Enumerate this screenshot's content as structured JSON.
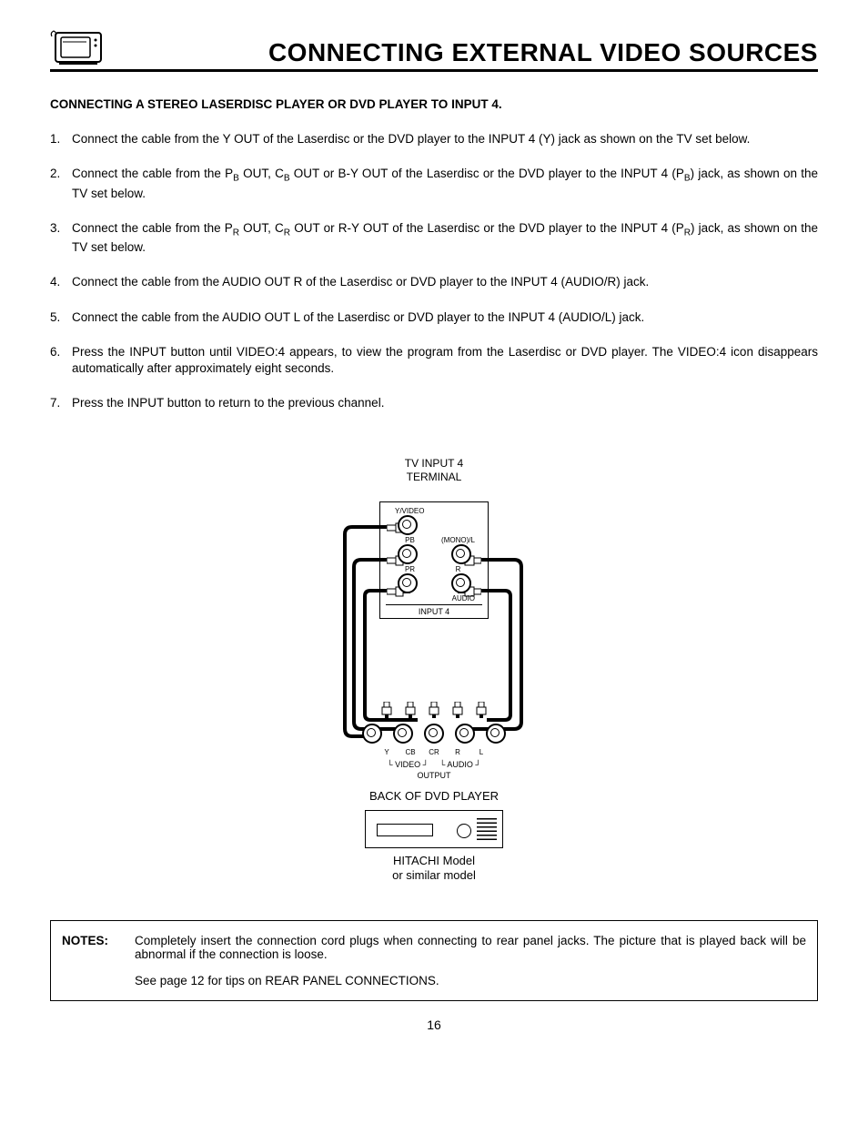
{
  "header": {
    "title": "CONNECTING EXTERNAL VIDEO SOURCES"
  },
  "subtitle": "CONNECTING A STEREO LASERDISC PLAYER OR DVD PLAYER TO INPUT 4.",
  "steps": [
    {
      "text_parts": [
        "Connect  the cable from the Y OUT of the Laserdisc or the DVD player to the INPUT 4 (Y) jack as shown on the TV set below."
      ]
    },
    {
      "text_parts": [
        "Connect the cable from the P",
        {
          "sub": "B"
        },
        " OUT, C",
        {
          "sub": "B"
        },
        " OUT or B-Y OUT of the Laserdisc or the DVD player to the INPUT 4 (P",
        {
          "sub": "B"
        },
        ") jack, as shown on the TV set below."
      ]
    },
    {
      "text_parts": [
        "Connect the cable from the P",
        {
          "sub": "R"
        },
        " OUT, C",
        {
          "sub": "R"
        },
        " OUT or R-Y OUT of the Laserdisc or the DVD player to the INPUT 4 (P",
        {
          "sub": "R"
        },
        ") jack, as shown on the TV set below."
      ]
    },
    {
      "text_parts": [
        "Connect the cable from the AUDIO OUT R of the Laserdisc or DVD player to the INPUT 4 (AUDIO/R) jack."
      ]
    },
    {
      "text_parts": [
        "Connect the cable from the AUDIO OUT L of the Laserdisc or DVD player to the INPUT 4 (AUDIO/L) jack."
      ]
    },
    {
      "text_parts": [
        "Press the INPUT button until VIDEO:4 appears, to view the program from the Laserdisc or DVD player.  The VIDEO:4 icon disappears automatically after approximately eight seconds."
      ]
    },
    {
      "text_parts": [
        "Press the INPUT button to return to the previous channel."
      ]
    }
  ],
  "diagram": {
    "title_line1": "TV INPUT 4",
    "title_line2": "TERMINAL",
    "jack_labels": {
      "yvideo": "Y/VIDEO",
      "pb": "PB",
      "monol": "(MONO)/L",
      "pr": "PR",
      "r": "R",
      "audio": "AUDIO",
      "input4": "INPUT 4"
    },
    "dvd_out": {
      "labels": [
        "Y",
        "CB",
        "CR",
        "R",
        "L"
      ],
      "groups": [
        "VIDEO",
        "AUDIO"
      ],
      "output": "OUTPUT"
    },
    "dvd_caption": "BACK OF DVD PLAYER",
    "model_line1": "HITACHI Model",
    "model_line2": "or similar model"
  },
  "notes": {
    "label": "NOTES:",
    "body1": "Completely insert the connection cord plugs when connecting to rear panel jacks.  The picture that is played back will be abnormal if the connection is loose.",
    "body2": "See page 12 for tips on REAR PANEL CONNECTIONS."
  },
  "page_number": "16"
}
